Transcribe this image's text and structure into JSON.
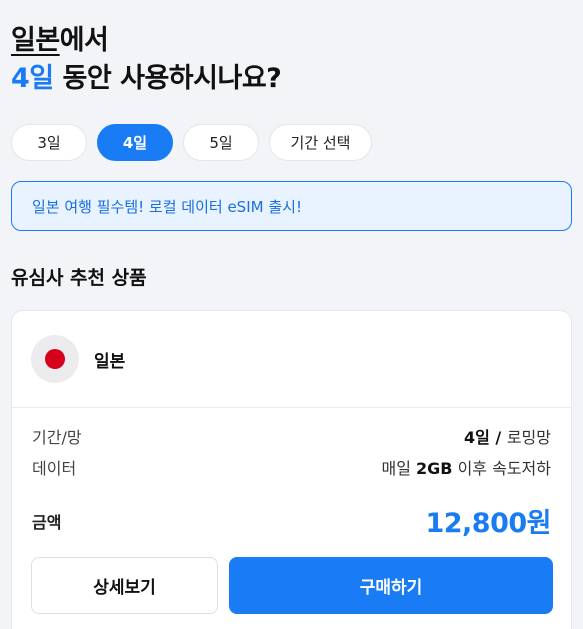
{
  "headline": {
    "country": "일본",
    "suffix1": "에서",
    "days": "4일",
    "suffix2": " 동안 사용하시나요?"
  },
  "duration_chips": [
    {
      "label": "3일",
      "selected": false
    },
    {
      "label": "4일",
      "selected": true
    },
    {
      "label": "5일",
      "selected": false
    },
    {
      "label": "기간 선택",
      "selected": false
    }
  ],
  "banner": {
    "text": "일본 여행 필수템! 로컬 데이터 eSIM 출시!"
  },
  "section": {
    "title": "유심사 추천 상품"
  },
  "product": {
    "flag_icon": "japan-flag-icon",
    "flag_color": "#d7001a",
    "country": "일본",
    "rows": [
      {
        "label": "기간/망",
        "value_pre": "",
        "value_bold": "4일 / ",
        "value_post": "로밍망"
      },
      {
        "label": "데이터",
        "value_pre": "매일 ",
        "value_bold": "2GB",
        "value_post": " 이후 속도저하"
      }
    ],
    "price_label": "금액",
    "price": "12,800원",
    "detail_button": "상세보기",
    "buy_button": "구매하기"
  },
  "colors": {
    "accent": "#1a7cf5",
    "banner_bg": "#e8f3ff"
  }
}
